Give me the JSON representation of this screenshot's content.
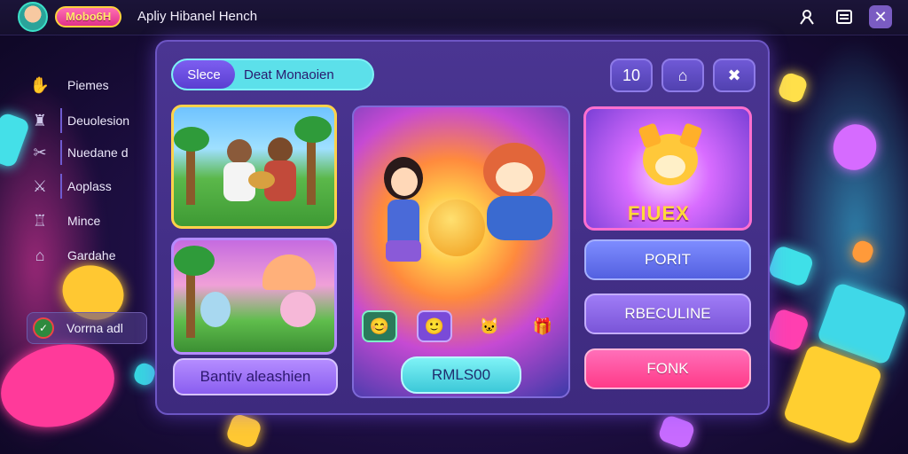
{
  "header": {
    "brand": "Mobo6H",
    "title": "Apliy Hibanel Hench"
  },
  "icons": {
    "profile": "profile-icon",
    "list": "list-icon",
    "close": "close-icon"
  },
  "sidebar": {
    "items": [
      {
        "label": "Piemes",
        "icon": "hand-icon"
      },
      {
        "label": "Deuolesion",
        "icon": "trophy-icon"
      },
      {
        "label": "Nuedane d",
        "icon": "tools-icon"
      },
      {
        "label": "Aoplass",
        "icon": "swords-icon"
      },
      {
        "label": "Mince",
        "icon": "castle-icon"
      },
      {
        "label": "Gardahe",
        "icon": "shop-icon"
      }
    ],
    "footer_label": "Vorrna adl"
  },
  "main": {
    "tabs": [
      {
        "label": "Slece",
        "active": true
      },
      {
        "label": "Deat Monaoien",
        "active": false
      }
    ],
    "counter": "10",
    "gallery_button": "Bantiv aleashien",
    "play_button": "RMLS00",
    "promo_text": "FIUEX",
    "action_buttons": [
      "PORIT",
      "RBECULINE",
      "FONK"
    ]
  },
  "colors": {
    "accent_cyan": "#5ce0ea",
    "accent_purple": "#7d5ef0",
    "accent_pink": "#ff3a88",
    "accent_gold": "#ffd24a"
  }
}
